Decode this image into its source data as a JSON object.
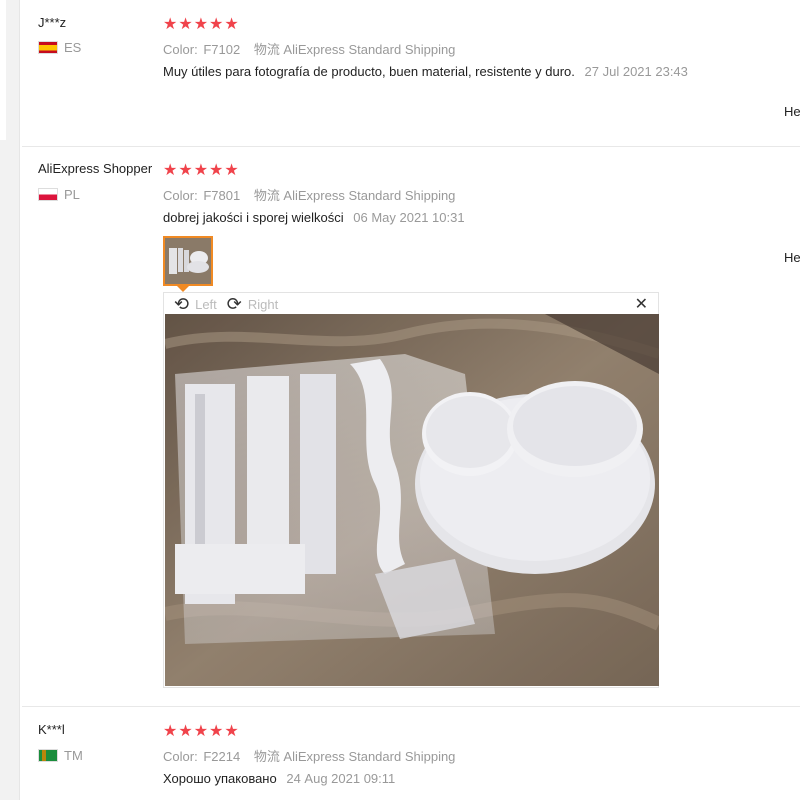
{
  "reviews": [
    {
      "name": "J***z",
      "country": "ES",
      "rating_stars": "★★★★★",
      "rating": 5,
      "color_label": "Color:",
      "color_value": "F7102",
      "shipping": "物流 AliExpress Standard Shipping",
      "text": "Muy útiles para fotografía de producto, buen material, resistente y duro.",
      "date": "27 Jul 2021 23:43",
      "helpful": "He"
    },
    {
      "name": "AliExpress Shopper",
      "country": "PL",
      "rating_stars": "★★★★★",
      "rating": 5,
      "color_label": "Color:",
      "color_value": "F7801",
      "shipping": "物流 AliExpress Standard Shipping",
      "text": "dobrej jakości i sporej wielkości",
      "date": "06 May 2021 10:31",
      "helpful": "He"
    },
    {
      "name": "K***l",
      "country": "TM",
      "rating_stars": "★★★★★",
      "rating": 5,
      "color_label": "Color:",
      "color_value": "F2214",
      "shipping": "物流 AliExpress Standard Shipping",
      "text": "Хорошо упаковано",
      "date": "24 Aug 2021 09:11"
    }
  ],
  "viewer": {
    "rotate_left_label": "Left",
    "rotate_right_label": "Right",
    "rotate_left_icon": "rotate-left-icon",
    "rotate_right_icon": "rotate-right-icon",
    "close_icon": "close-icon"
  },
  "colors": {
    "star": "#f0434b",
    "thumb_border": "#f08a24",
    "meta_text": "#999999"
  }
}
